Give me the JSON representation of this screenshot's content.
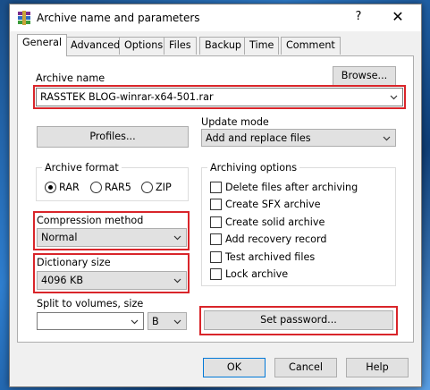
{
  "window": {
    "title": "Archive name and parameters",
    "help": "?",
    "close": "✕"
  },
  "tabs": [
    {
      "label": "General"
    },
    {
      "label": "Advanced"
    },
    {
      "label": "Options"
    },
    {
      "label": "Files"
    },
    {
      "label": "Backup"
    },
    {
      "label": "Time"
    },
    {
      "label": "Comment"
    }
  ],
  "archive_name": {
    "label": "Archive name",
    "value": "RASSTEK BLOG-winrar-x64-501.rar",
    "browse": "Browse..."
  },
  "profiles": {
    "label": "Profiles..."
  },
  "update_mode": {
    "label": "Update mode",
    "value": "Add and replace files"
  },
  "archive_format": {
    "title": "Archive format",
    "options": [
      {
        "label": "RAR",
        "checked": true
      },
      {
        "label": "RAR5",
        "checked": false
      },
      {
        "label": "ZIP",
        "checked": false
      }
    ]
  },
  "compression": {
    "label": "Compression method",
    "value": "Normal"
  },
  "dictionary": {
    "label": "Dictionary size",
    "value": "4096 KB"
  },
  "split": {
    "label": "Split to volumes, size",
    "value": "",
    "unit": "B"
  },
  "archiving_options": {
    "title": "Archiving options",
    "items": [
      {
        "label": "Delete files after archiving",
        "checked": false
      },
      {
        "label": "Create SFX archive",
        "checked": false
      },
      {
        "label": "Create solid archive",
        "checked": false
      },
      {
        "label": "Add recovery record",
        "checked": false
      },
      {
        "label": "Test archived files",
        "checked": false
      },
      {
        "label": "Lock archive",
        "checked": false
      }
    ]
  },
  "set_password": {
    "label": "Set password..."
  },
  "footer": {
    "ok": "OK",
    "cancel": "Cancel",
    "help": "Help"
  },
  "colors": {
    "highlight_box": "#d9252a",
    "window_bg": "#f0f0f0",
    "panel_bg": "#ffffff"
  }
}
